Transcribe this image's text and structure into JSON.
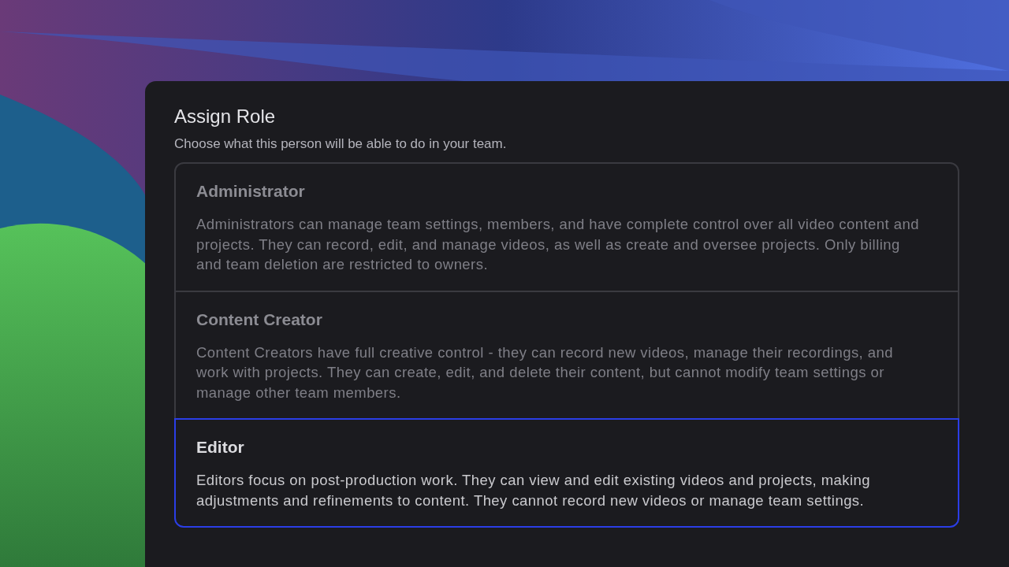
{
  "dialog": {
    "title": "Assign Role",
    "subtitle": "Choose what this person will be able to do in your team."
  },
  "roles": [
    {
      "name": "Administrator",
      "description": "Administrators can manage team settings, members, and have complete control over all video content and projects. They can record, edit, and manage videos, as well as create and oversee projects. Only billing and team deletion are restricted to owners.",
      "selected": false
    },
    {
      "name": "Content Creator",
      "description": "Content Creators have full creative control - they can record new videos, manage their recordings, and work with projects. They can create, edit, and delete their content, but cannot modify team settings or manage other team members.",
      "selected": false
    },
    {
      "name": "Editor",
      "description": "Editors focus on post-production work. They can view and edit existing videos and projects, making adjustments and refinements to content. They cannot record new videos or manage team settings.",
      "selected": true
    }
  ]
}
